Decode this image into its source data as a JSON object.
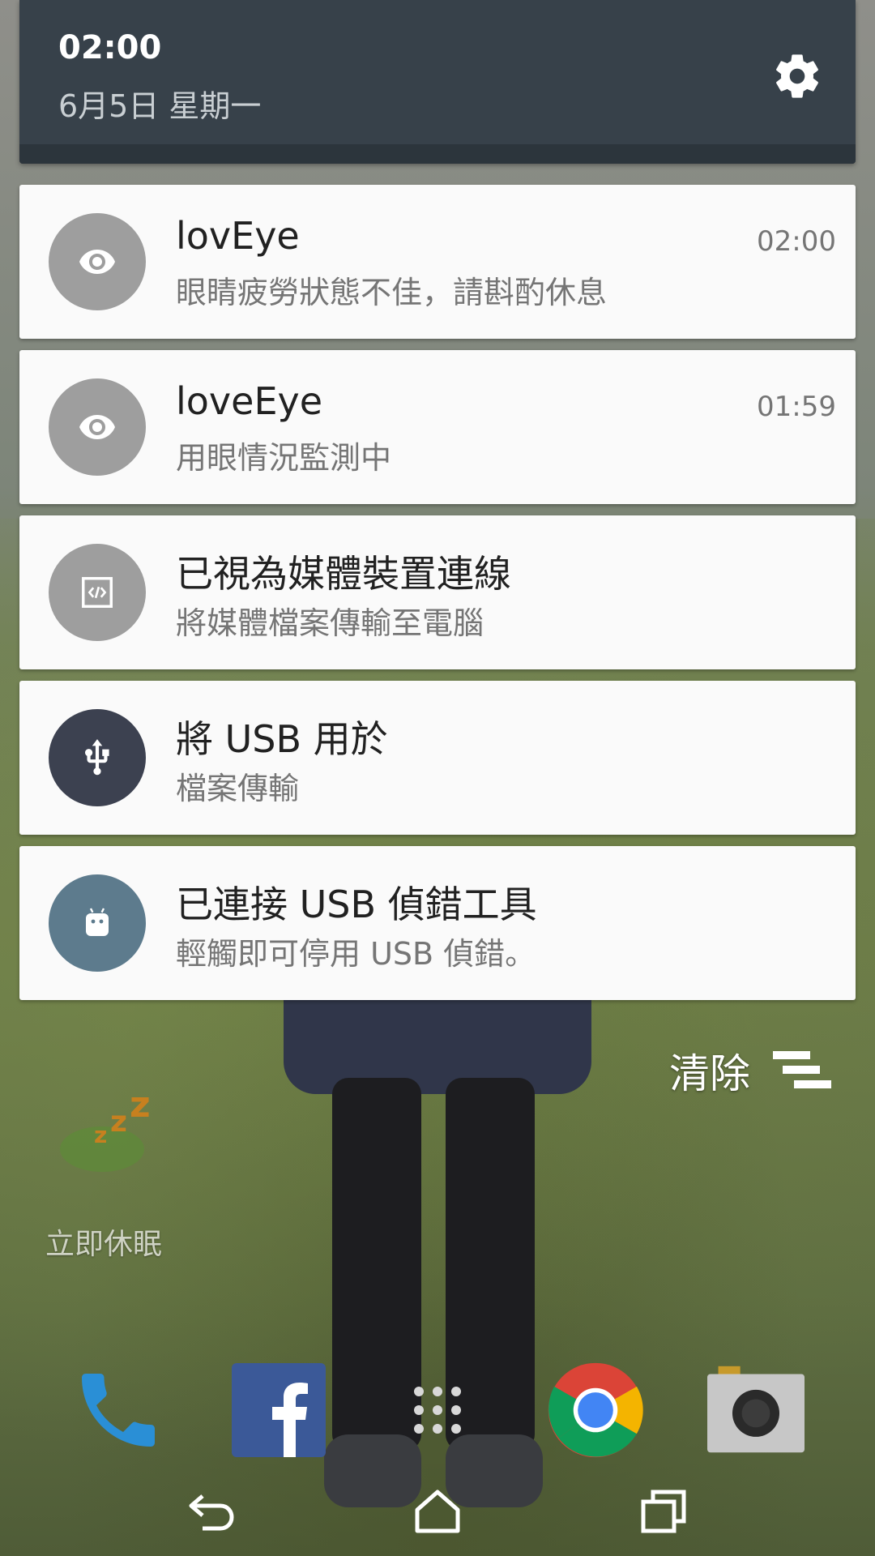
{
  "shade": {
    "time": "02:00",
    "date": "6月5日 星期一",
    "settings_icon": "gear-icon"
  },
  "notifications": [
    {
      "title": "lovEye",
      "text": "眼睛疲勞狀態不佳，請斟酌休息",
      "time": "02:00",
      "icon": "eye-icon",
      "icon_bg": "#9e9e9e"
    },
    {
      "title": "loveEye",
      "text": "用眼情況監測中",
      "time": "01:59",
      "icon": "eye-icon",
      "icon_bg": "#9e9e9e"
    },
    {
      "title": "已視為媒體裝置連線",
      "text": "將媒體檔案傳輸至電腦",
      "time": "",
      "icon": "code-icon",
      "icon_bg": "#9e9e9e"
    },
    {
      "title": "將 USB 用於",
      "text": "檔案傳輸",
      "time": "",
      "icon": "usb-icon",
      "icon_bg": "#3c4150"
    },
    {
      "title": "已連接 USB 偵錯工具",
      "text": "輕觸即可停用 USB 偵錯。",
      "time": "",
      "icon": "android-icon",
      "icon_bg": "#5d7b8d"
    }
  ],
  "clear": {
    "label": "清除",
    "icon": "clear-all-icon"
  },
  "widget": {
    "label": "立即休眠",
    "icon": "sleep-zzz-icon"
  },
  "dock": [
    "phone-icon",
    "facebook-icon",
    "app-drawer-icon",
    "chrome-icon",
    "camera-icon"
  ],
  "navbar": [
    "back-icon",
    "home-icon",
    "recents-icon"
  ],
  "colors": {
    "shade_bg": "#37414a",
    "card_bg": "#fafafa",
    "title_text": "#212121",
    "secondary_text": "#757575"
  }
}
